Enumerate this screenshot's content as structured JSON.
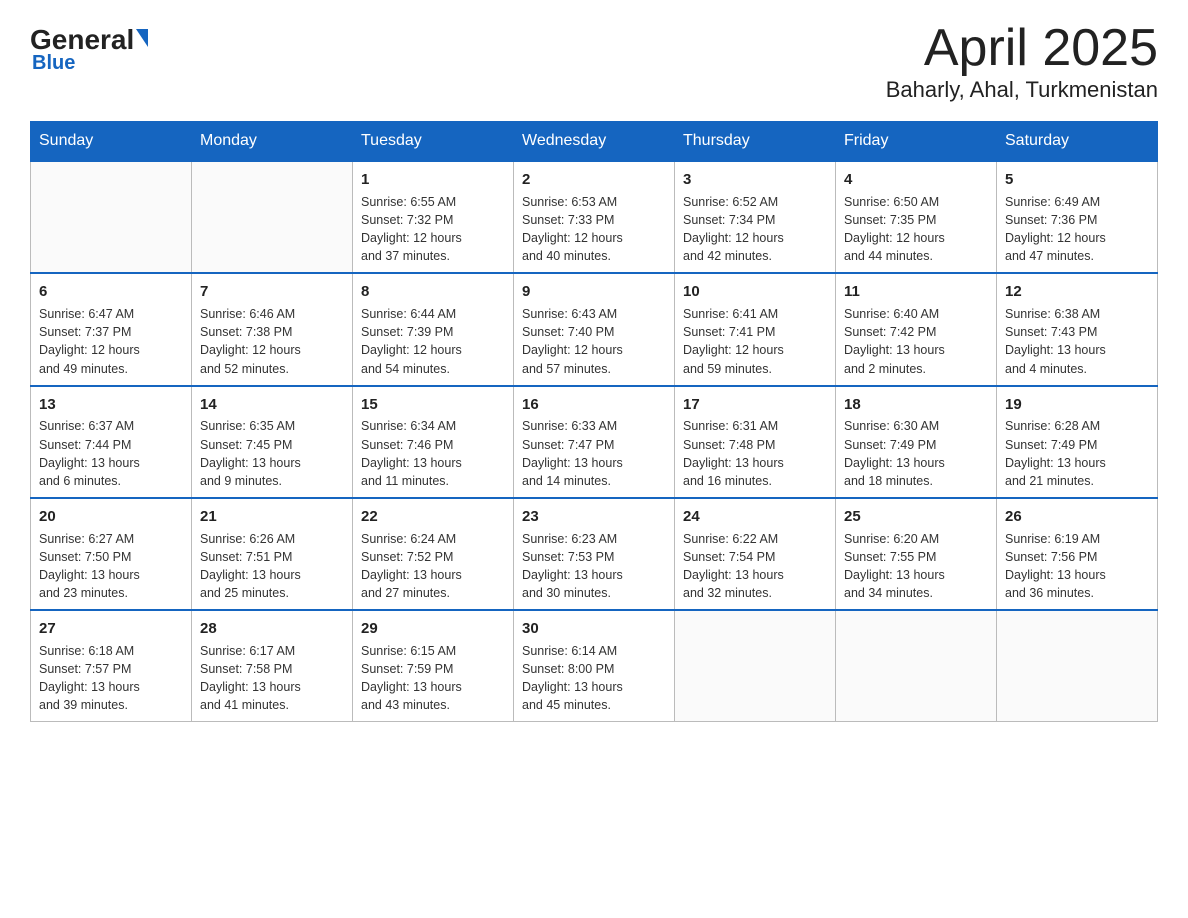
{
  "header": {
    "logo": {
      "general": "General",
      "blue": "Blue",
      "triangle_color": "#1565c0"
    },
    "month": "April 2025",
    "location": "Baharly, Ahal, Turkmenistan"
  },
  "days_of_week": [
    "Sunday",
    "Monday",
    "Tuesday",
    "Wednesday",
    "Thursday",
    "Friday",
    "Saturday"
  ],
  "weeks": [
    [
      {
        "num": "",
        "detail": ""
      },
      {
        "num": "",
        "detail": ""
      },
      {
        "num": "1",
        "detail": "Sunrise: 6:55 AM\nSunset: 7:32 PM\nDaylight: 12 hours\nand 37 minutes."
      },
      {
        "num": "2",
        "detail": "Sunrise: 6:53 AM\nSunset: 7:33 PM\nDaylight: 12 hours\nand 40 minutes."
      },
      {
        "num": "3",
        "detail": "Sunrise: 6:52 AM\nSunset: 7:34 PM\nDaylight: 12 hours\nand 42 minutes."
      },
      {
        "num": "4",
        "detail": "Sunrise: 6:50 AM\nSunset: 7:35 PM\nDaylight: 12 hours\nand 44 minutes."
      },
      {
        "num": "5",
        "detail": "Sunrise: 6:49 AM\nSunset: 7:36 PM\nDaylight: 12 hours\nand 47 minutes."
      }
    ],
    [
      {
        "num": "6",
        "detail": "Sunrise: 6:47 AM\nSunset: 7:37 PM\nDaylight: 12 hours\nand 49 minutes."
      },
      {
        "num": "7",
        "detail": "Sunrise: 6:46 AM\nSunset: 7:38 PM\nDaylight: 12 hours\nand 52 minutes."
      },
      {
        "num": "8",
        "detail": "Sunrise: 6:44 AM\nSunset: 7:39 PM\nDaylight: 12 hours\nand 54 minutes."
      },
      {
        "num": "9",
        "detail": "Sunrise: 6:43 AM\nSunset: 7:40 PM\nDaylight: 12 hours\nand 57 minutes."
      },
      {
        "num": "10",
        "detail": "Sunrise: 6:41 AM\nSunset: 7:41 PM\nDaylight: 12 hours\nand 59 minutes."
      },
      {
        "num": "11",
        "detail": "Sunrise: 6:40 AM\nSunset: 7:42 PM\nDaylight: 13 hours\nand 2 minutes."
      },
      {
        "num": "12",
        "detail": "Sunrise: 6:38 AM\nSunset: 7:43 PM\nDaylight: 13 hours\nand 4 minutes."
      }
    ],
    [
      {
        "num": "13",
        "detail": "Sunrise: 6:37 AM\nSunset: 7:44 PM\nDaylight: 13 hours\nand 6 minutes."
      },
      {
        "num": "14",
        "detail": "Sunrise: 6:35 AM\nSunset: 7:45 PM\nDaylight: 13 hours\nand 9 minutes."
      },
      {
        "num": "15",
        "detail": "Sunrise: 6:34 AM\nSunset: 7:46 PM\nDaylight: 13 hours\nand 11 minutes."
      },
      {
        "num": "16",
        "detail": "Sunrise: 6:33 AM\nSunset: 7:47 PM\nDaylight: 13 hours\nand 14 minutes."
      },
      {
        "num": "17",
        "detail": "Sunrise: 6:31 AM\nSunset: 7:48 PM\nDaylight: 13 hours\nand 16 minutes."
      },
      {
        "num": "18",
        "detail": "Sunrise: 6:30 AM\nSunset: 7:49 PM\nDaylight: 13 hours\nand 18 minutes."
      },
      {
        "num": "19",
        "detail": "Sunrise: 6:28 AM\nSunset: 7:49 PM\nDaylight: 13 hours\nand 21 minutes."
      }
    ],
    [
      {
        "num": "20",
        "detail": "Sunrise: 6:27 AM\nSunset: 7:50 PM\nDaylight: 13 hours\nand 23 minutes."
      },
      {
        "num": "21",
        "detail": "Sunrise: 6:26 AM\nSunset: 7:51 PM\nDaylight: 13 hours\nand 25 minutes."
      },
      {
        "num": "22",
        "detail": "Sunrise: 6:24 AM\nSunset: 7:52 PM\nDaylight: 13 hours\nand 27 minutes."
      },
      {
        "num": "23",
        "detail": "Sunrise: 6:23 AM\nSunset: 7:53 PM\nDaylight: 13 hours\nand 30 minutes."
      },
      {
        "num": "24",
        "detail": "Sunrise: 6:22 AM\nSunset: 7:54 PM\nDaylight: 13 hours\nand 32 minutes."
      },
      {
        "num": "25",
        "detail": "Sunrise: 6:20 AM\nSunset: 7:55 PM\nDaylight: 13 hours\nand 34 minutes."
      },
      {
        "num": "26",
        "detail": "Sunrise: 6:19 AM\nSunset: 7:56 PM\nDaylight: 13 hours\nand 36 minutes."
      }
    ],
    [
      {
        "num": "27",
        "detail": "Sunrise: 6:18 AM\nSunset: 7:57 PM\nDaylight: 13 hours\nand 39 minutes."
      },
      {
        "num": "28",
        "detail": "Sunrise: 6:17 AM\nSunset: 7:58 PM\nDaylight: 13 hours\nand 41 minutes."
      },
      {
        "num": "29",
        "detail": "Sunrise: 6:15 AM\nSunset: 7:59 PM\nDaylight: 13 hours\nand 43 minutes."
      },
      {
        "num": "30",
        "detail": "Sunrise: 6:14 AM\nSunset: 8:00 PM\nDaylight: 13 hours\nand 45 minutes."
      },
      {
        "num": "",
        "detail": ""
      },
      {
        "num": "",
        "detail": ""
      },
      {
        "num": "",
        "detail": ""
      }
    ]
  ]
}
